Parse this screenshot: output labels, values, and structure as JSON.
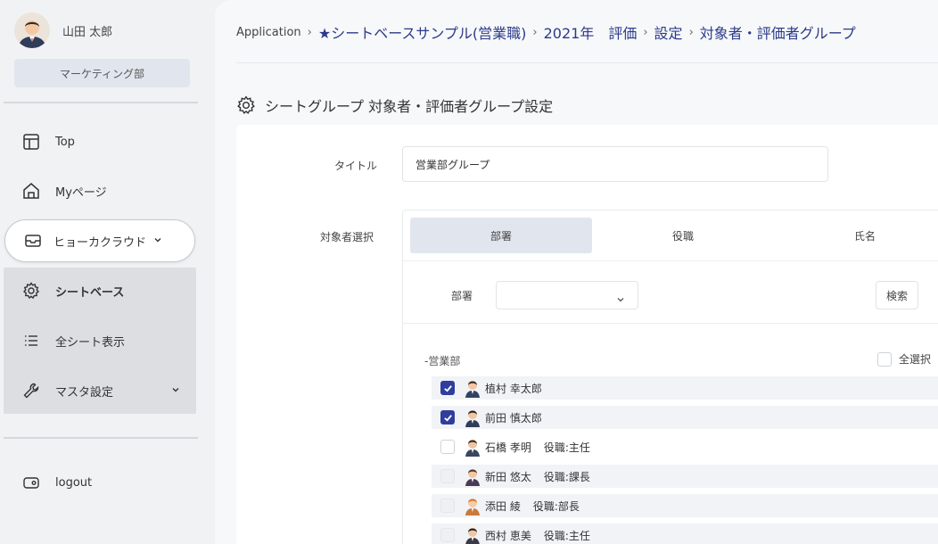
{
  "user": {
    "name": "山田 太郎",
    "department": "マーケティング部"
  },
  "nav": {
    "top": "Top",
    "mypage": "Myページ",
    "viewcloud": "ヒョーカクラウド",
    "sheetbase": "シートベース",
    "all_sheets": "全シート表示",
    "master": "マスタ設定",
    "logout": "logout"
  },
  "breadcrumb": {
    "app": "Application",
    "sample": "★シートベースサンプル(営業職)",
    "year": "2021年　評価",
    "settings": "設定",
    "group": "対象者・評価者グループ"
  },
  "page_title": "シートグループ 対象者・評価者グループ設定",
  "form": {
    "title_label": "タイトル",
    "title_value": "営業部グループ",
    "target_label": "対象者選択"
  },
  "tabs": {
    "dept": "部署",
    "position": "役職",
    "name": "氏名"
  },
  "filter": {
    "dept_label": "部署",
    "dept_value": "",
    "search": "検索"
  },
  "group": {
    "label": "-営業部",
    "select_all": "全選択"
  },
  "people": [
    {
      "name": "植村 幸太郎",
      "role": "",
      "state": "checked"
    },
    {
      "name": "前田 慎太郎",
      "role": "",
      "state": "checked"
    },
    {
      "name": "石橋 孝明",
      "role": "役職:主任",
      "state": "unchecked"
    },
    {
      "name": "新田 悠太",
      "role": "役職:課長",
      "state": "disabled"
    },
    {
      "name": "添田 綾",
      "role": "役職:部長",
      "state": "disabled"
    },
    {
      "name": "西村 恵美",
      "role": "役職:主任",
      "state": "disabled"
    }
  ],
  "colors": {
    "accent": "#2f3e9e",
    "selected_tab": "#e1e6ee",
    "breadcrumb": "#2b3a8a"
  }
}
